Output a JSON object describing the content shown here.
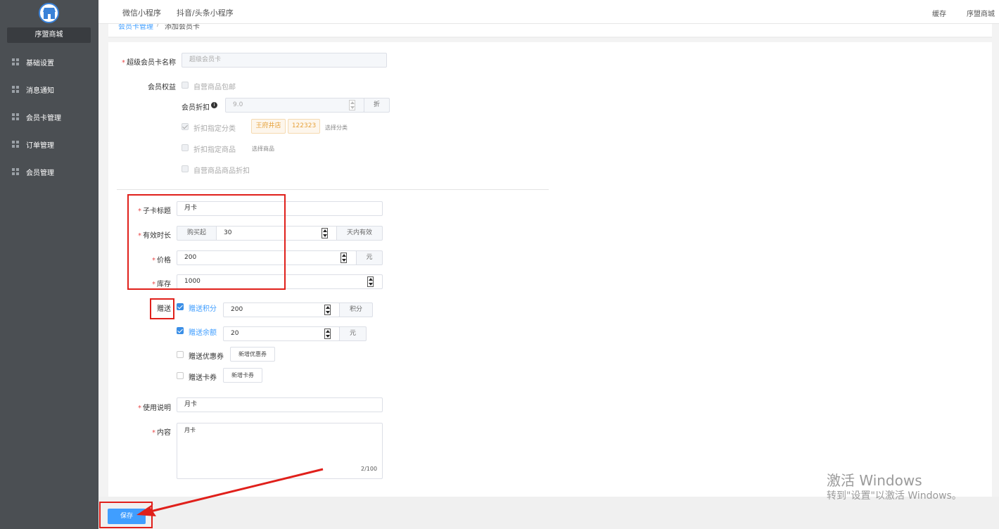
{
  "sidebar": {
    "store_name": "序盟商城",
    "items": [
      {
        "label": "基础设置",
        "icon": "grid-icon"
      },
      {
        "label": "消息通知",
        "icon": "grid-icon"
      },
      {
        "label": "会员卡管理",
        "icon": "grid-icon"
      },
      {
        "label": "订单管理",
        "icon": "grid-icon"
      },
      {
        "label": "会员管理",
        "icon": "grid-icon"
      }
    ]
  },
  "topbar": {
    "tabs": [
      "微信小程序",
      "抖音/头条小程序"
    ],
    "cache": "缓存",
    "account": "序盟商城"
  },
  "breadcrumb": {
    "parent": "会员卡管理",
    "sep": "/",
    "current": "添加会员卡"
  },
  "form": {
    "card_name": {
      "label": "超级会员卡名称",
      "placeholder": "超级会员卡"
    },
    "benefits": {
      "label": "会员权益",
      "free_shipping": "自营商品包邮",
      "discount_label": "会员折扣",
      "discount_value": "9.0",
      "discount_unit": "折",
      "by_category": "折扣指定分类",
      "category_tags": [
        "王府井店",
        "122323"
      ],
      "choose_category": "选择分类",
      "by_goods": "折扣指定商品",
      "choose_goods": "选择商品",
      "self_goods_discount": "自营商品商品折扣"
    },
    "sub_title": {
      "label": "子卡标题",
      "value": "月卡"
    },
    "duration": {
      "label": "有效时长",
      "prefix": "购买起",
      "value": "30",
      "suffix": "天内有效"
    },
    "price": {
      "label": "价格",
      "value": "200",
      "suffix": "元"
    },
    "stock": {
      "label": "库存",
      "value": "1000"
    },
    "gift": {
      "label": "赠送",
      "points_label": "赠送积分",
      "points_value": "200",
      "points_unit": "积分",
      "balance_label": "赠送余额",
      "balance_value": "20",
      "balance_unit": "元",
      "coupon_label": "赠送优惠券",
      "coupon_button": "新增优惠券",
      "card_label": "赠送卡券",
      "card_button": "新增卡券"
    },
    "usage": {
      "label": "使用说明",
      "value": "月卡"
    },
    "content": {
      "label": "内容",
      "value": "月卡",
      "counter": "2/100"
    }
  },
  "save_button": "保存",
  "watermark": {
    "line1": "激活 Windows",
    "line2": "转到\"设置\"以激活 Windows。"
  },
  "colors": {
    "annotation": "#e0201b",
    "primary": "#409eff",
    "sidebar": "#4b4f53"
  }
}
